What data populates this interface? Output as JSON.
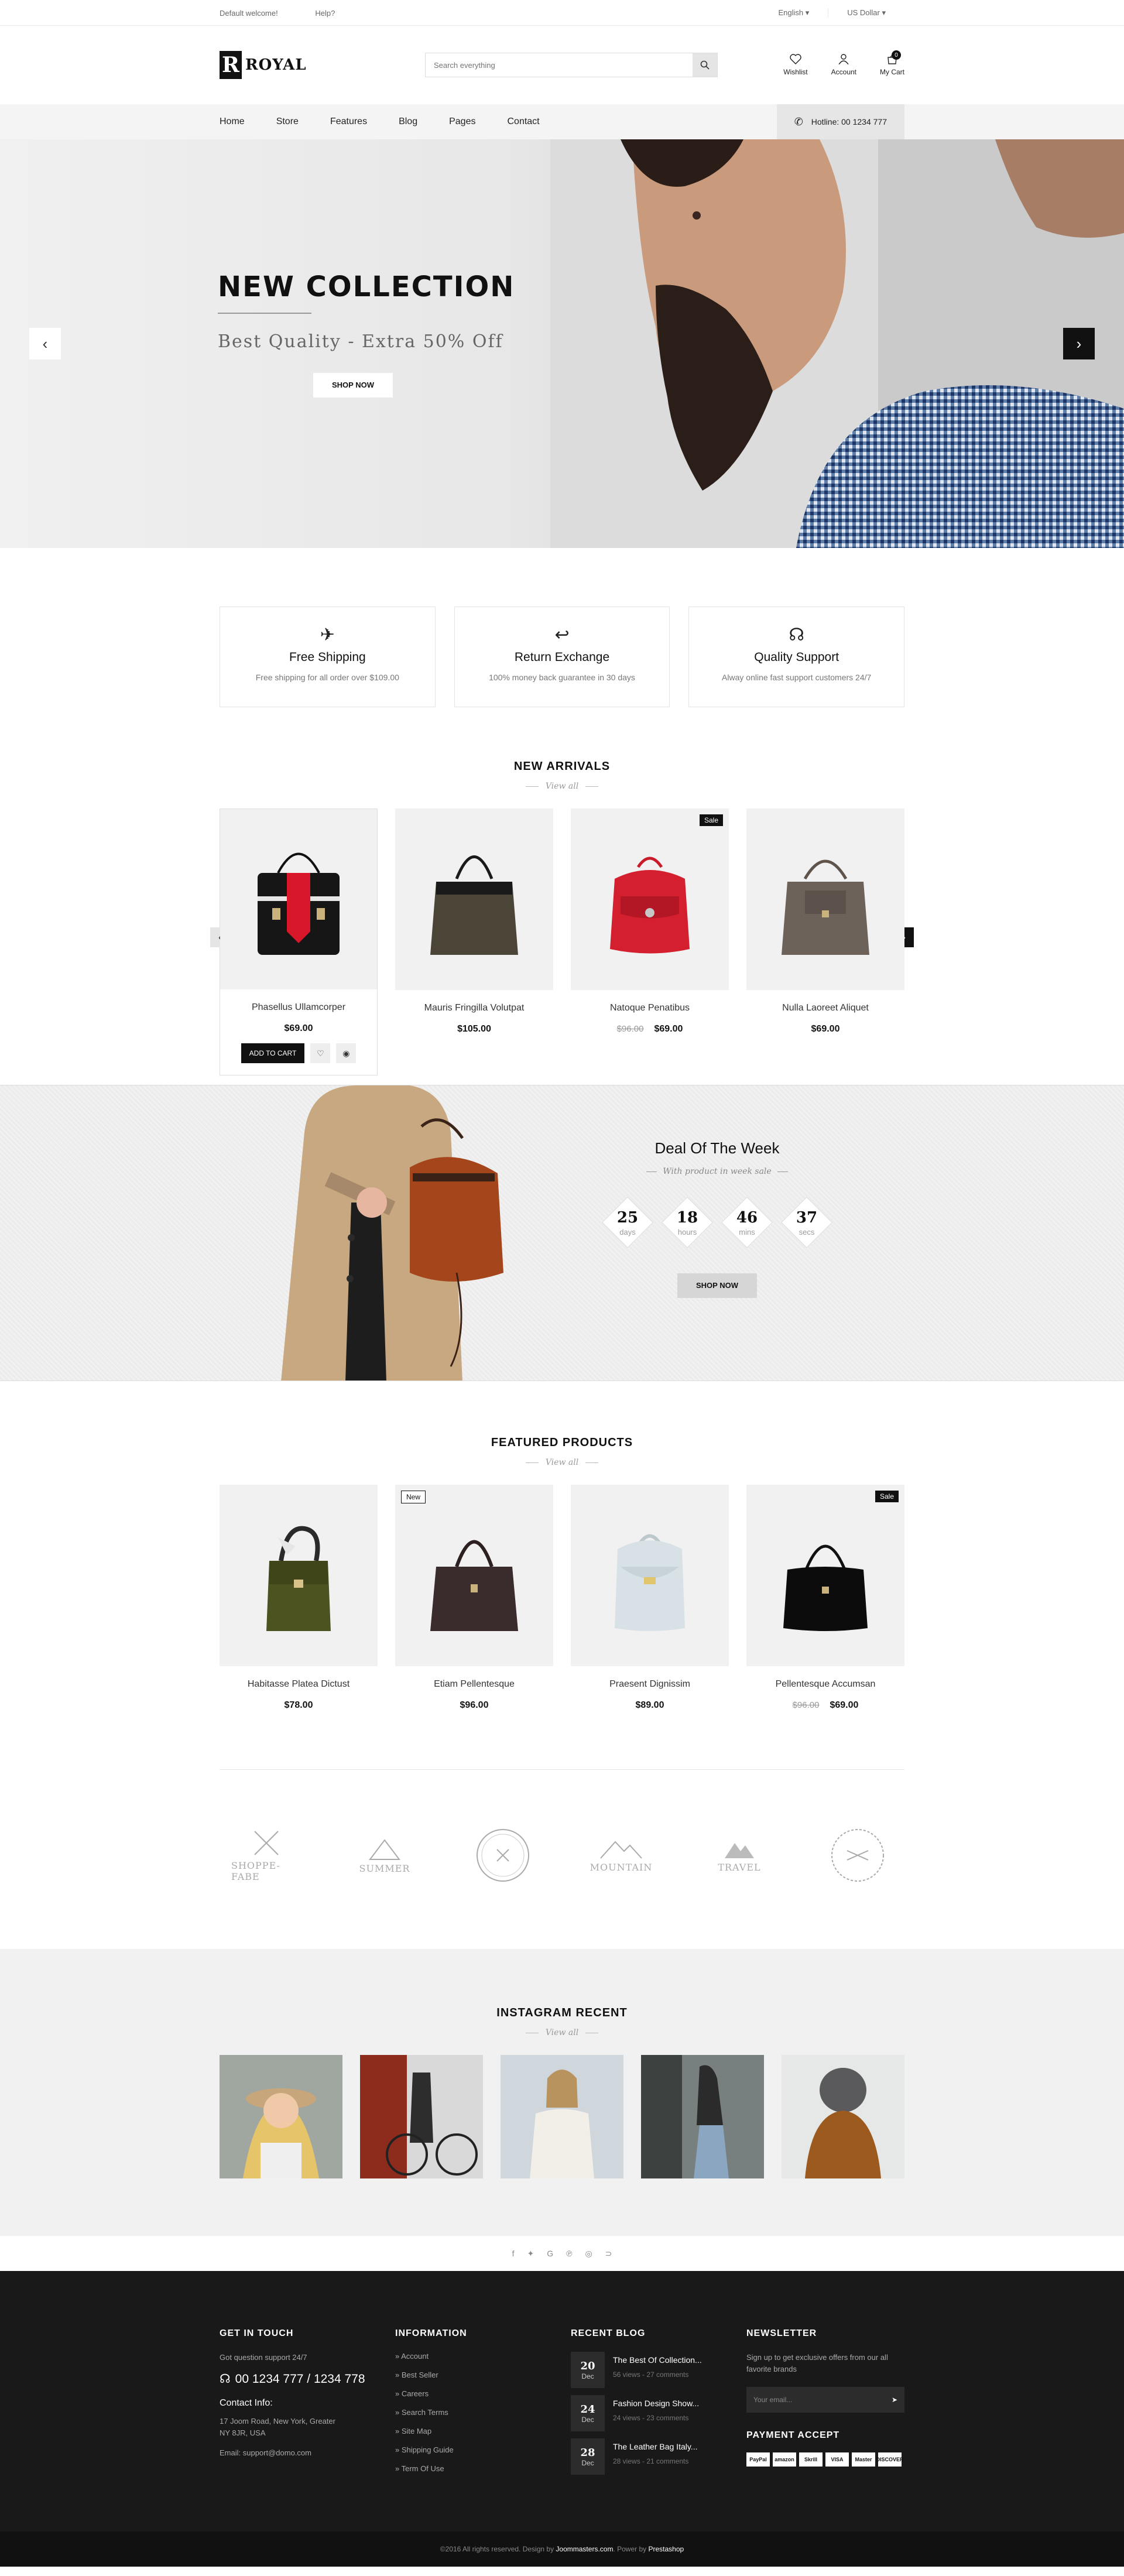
{
  "topbar": {
    "welcome": "Default welcome!",
    "help": "Help?",
    "language": "English",
    "currency": "US Dollar"
  },
  "header": {
    "logo_mark": "R",
    "logo_text": "ROYAL",
    "search_placeholder": "Search everything",
    "wishlist": "Wishlist",
    "account": "Account",
    "cart": "My Cart",
    "cart_count": "0"
  },
  "nav": {
    "items": [
      "Home",
      "Store",
      "Features",
      "Blog",
      "Pages",
      "Contact"
    ],
    "hotline": "Hotline: 00 1234 777"
  },
  "hero": {
    "title": "NEW COLLECTION",
    "subtitle": "Best Quality -  Extra 50% Off",
    "cta": "SHOP NOW"
  },
  "services": [
    {
      "title": "Free Shipping",
      "desc": "Free shipping for all order over $109.00",
      "icon": "plane-icon"
    },
    {
      "title": "Return Exchange",
      "desc": "100% money back guarantee in 30 days",
      "icon": "return-icon"
    },
    {
      "title": "Quality Support",
      "desc": "Alway online fast support customers 24/7",
      "icon": "headset-icon"
    }
  ],
  "arrivals": {
    "title": "NEW ARRIVALS",
    "view_all": "View all",
    "add_to_cart": "ADD TO CART",
    "products": [
      {
        "name": "Phasellus Ullamcorper",
        "price": "$69.00",
        "old": ""
      },
      {
        "name": "Mauris Fringilla Volutpat",
        "price": "$105.00",
        "old": ""
      },
      {
        "name": "Natoque Penatibus",
        "price": "$69.00",
        "old": "$96.00",
        "badge": "Sale"
      },
      {
        "name": "Nulla Laoreet Aliquet",
        "price": "$69.00",
        "old": ""
      }
    ]
  },
  "deal": {
    "title": "Deal Of The Week",
    "subtitle": "With product in week sale",
    "days": "25",
    "days_label": "days",
    "hours": "18",
    "hours_label": "hours",
    "mins": "46",
    "mins_label": "mins",
    "secs": "37",
    "secs_label": "secs",
    "cta": "SHOP NOW"
  },
  "featured": {
    "title": "FEATURED PRODUCTS",
    "view_all": "View all",
    "products": [
      {
        "name": "Habitasse Platea Dictust",
        "price": "$78.00",
        "old": ""
      },
      {
        "name": "Etiam Pellentesque",
        "price": "$96.00",
        "old": "",
        "badge": "New"
      },
      {
        "name": "Praesent Dignissim",
        "price": "$89.00",
        "old": ""
      },
      {
        "name": "Pellentesque Accumsan",
        "price": "$69.00",
        "old": "$96.00",
        "badge": "Sale"
      }
    ]
  },
  "brands": [
    "SHOPPE-FABE",
    "SUMMER",
    "",
    "MOUNTAIN",
    "TRAVEL",
    ""
  ],
  "instagram": {
    "title": "INSTAGRAM RECENT",
    "view_all": "View all"
  },
  "footer": {
    "touch": {
      "title": "GET IN TOUCH",
      "question": "Got question support 24/7",
      "phone": "00 1234 777 / 1234 778",
      "contact_title": "Contact Info:",
      "address1": "17 Joom Road, New York, Greater",
      "address2": "NY 8JR, USA",
      "email": "Email: support@domo.com"
    },
    "info": {
      "title": "INFORMATION",
      "links": [
        "Account",
        "Best Seller",
        "Careers",
        "Search Terms",
        "Site Map",
        "Shipping Guide",
        "Term Of Use"
      ]
    },
    "blog": {
      "title": "RECENT BLOG",
      "posts": [
        {
          "day": "20",
          "month": "Dec",
          "title": "The Best Of Collection...",
          "meta": "56 views - 27 comments"
        },
        {
          "day": "24",
          "month": "Dec",
          "title": "Fashion Design Show...",
          "meta": "24 views - 23 comments"
        },
        {
          "day": "28",
          "month": "Dec",
          "title": "The Leather Bag Italy...",
          "meta": "28 views - 21 comments"
        }
      ]
    },
    "newsletter": {
      "title": "NEWSLETTER",
      "desc": "Sign up to get  exclusive offers from our all favorite brands",
      "placeholder": "Your email...",
      "pay_title": "PAYMENT ACCEPT",
      "pay": [
        "PayPal",
        "amazon",
        "Skrill",
        "VISA",
        "Master",
        "DISCOVER"
      ]
    }
  },
  "copyright": {
    "text": "©2016 All rights reserved. Design by",
    "designer": "Joommasters.com",
    "power": ". Power by",
    "platform": "Prestashop"
  },
  "colors": {
    "dark": "#111111",
    "footer_bg": "#191919",
    "light_bg": "#f1f1f1"
  }
}
